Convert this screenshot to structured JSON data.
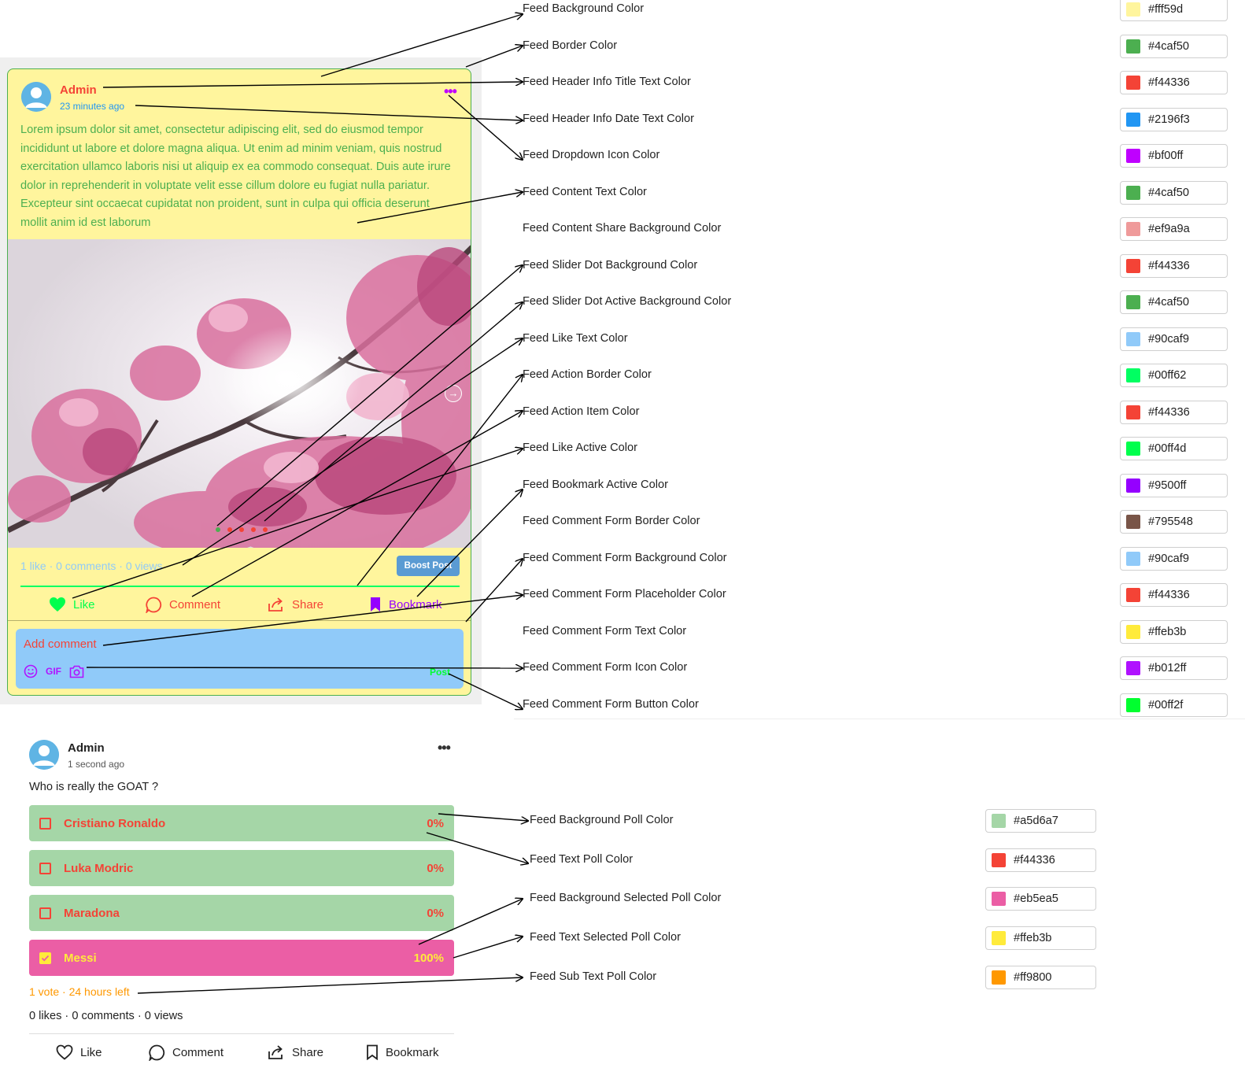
{
  "feed_card": {
    "author": "Admin",
    "time": "23 minutes ago",
    "content": "Lorem ipsum dolor sit amet, consectetur adipiscing elit, sed do eiusmod tempor incididunt ut labore et dolore magna aliqua. Ut enim ad minim veniam, quis nostrud exercitation ullamco laboris nisi ut aliquip ex ea commodo consequat. Duis aute irure dolor in reprehenderit in voluptate velit esse cillum dolore eu fugiat nulla pariatur. Excepteur sint occaecat cupidatat non proident, sunt in culpa qui officia deserunt mollit anim id est laborum",
    "stats": "1 like · 0 comments · 0 views",
    "boost_label": "Boost Post",
    "actions": {
      "like": "Like",
      "comment": "Comment",
      "share": "Share",
      "bookmark": "Bookmark"
    },
    "comment_placeholder": "Add comment",
    "gif_label": "GIF",
    "post_label": "Post",
    "colors": {
      "background": "#fff59d",
      "border": "#4caf50",
      "title": "#f44336",
      "date": "#2196f3",
      "dropdown": "#bf00ff",
      "content": "#4caf50",
      "dot": "#f44336",
      "dot_active": "#4caf50",
      "like_text": "#90caf9",
      "action_border": "#00ff62",
      "action_item": "#f44336",
      "like_active": "#00ff4d",
      "bookmark_active": "#9500ff",
      "form_bg": "#90caf9",
      "form_placeholder": "#f44336",
      "form_icon": "#b012ff",
      "form_button": "#00ff2f"
    }
  },
  "settings": [
    {
      "label": "Feed Background Color",
      "hex": "#fff59d"
    },
    {
      "label": "Feed Border Color",
      "hex": "#4caf50"
    },
    {
      "label": "Feed Header Info Title Text Color",
      "hex": "#f44336"
    },
    {
      "label": "Feed Header Info Date Text Color",
      "hex": "#2196f3"
    },
    {
      "label": "Feed Dropdown Icon Color",
      "hex": "#bf00ff"
    },
    {
      "label": "Feed Content Text Color",
      "hex": "#4caf50"
    },
    {
      "label": "Feed Content Share Background Color",
      "hex": "#ef9a9a"
    },
    {
      "label": "Feed Slider Dot Background Color",
      "hex": "#f44336"
    },
    {
      "label": "Feed Slider Dot Active Background Color",
      "hex": "#4caf50"
    },
    {
      "label": "Feed Like Text Color",
      "hex": "#90caf9"
    },
    {
      "label": "Feed Action Border Color",
      "hex": "#00ff62"
    },
    {
      "label": "Feed Action Item Color",
      "hex": "#f44336"
    },
    {
      "label": "Feed Like Active Color",
      "hex": "#00ff4d"
    },
    {
      "label": "Feed Bookmark Active Color",
      "hex": "#9500ff"
    },
    {
      "label": "Feed Comment Form Border Color",
      "hex": "#795548"
    },
    {
      "label": "Feed Comment Form Background Color",
      "hex": "#90caf9"
    },
    {
      "label": "Feed Comment Form Placeholder Color",
      "hex": "#f44336"
    },
    {
      "label": "Feed Comment Form Text Color",
      "hex": "#ffeb3b"
    },
    {
      "label": "Feed Comment Form Icon Color",
      "hex": "#b012ff"
    },
    {
      "label": "Feed Comment Form Button Color",
      "hex": "#00ff2f"
    }
  ],
  "poll_card": {
    "author": "Admin",
    "time": "1 second ago",
    "question": "Who is really the GOAT ?",
    "options": [
      {
        "label": "Cristiano Ronaldo",
        "percent": "0%",
        "selected": false
      },
      {
        "label": "Luka Modric",
        "percent": "0%",
        "selected": false
      },
      {
        "label": "Maradona",
        "percent": "0%",
        "selected": false
      },
      {
        "label": "Messi",
        "percent": "100%",
        "selected": true
      }
    ],
    "sub_text": "1 vote · 24 hours left",
    "stats": "0 likes · 0 comments · 0 views",
    "actions": {
      "like": "Like",
      "comment": "Comment",
      "share": "Share",
      "bookmark": "Bookmark"
    }
  },
  "poll_settings": [
    {
      "label": "Feed Background Poll Color",
      "hex": "#a5d6a7"
    },
    {
      "label": "Feed Text Poll Color",
      "hex": "#f44336"
    },
    {
      "label": "Feed Background Selected Poll Color",
      "hex": "#eb5ea5"
    },
    {
      "label": "Feed Text Selected Poll Color",
      "hex": "#ffeb3b"
    },
    {
      "label": "Feed Sub Text Poll Color",
      "hex": "#ff9800"
    }
  ]
}
